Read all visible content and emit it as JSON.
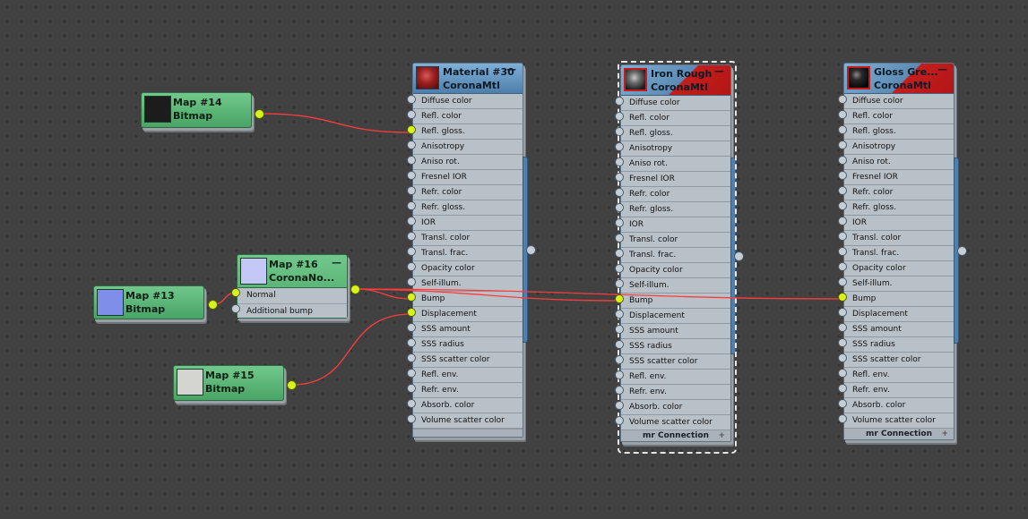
{
  "bitmap_nodes": [
    {
      "id": "map14",
      "title": "Map #14",
      "subtitle": "Bitmap",
      "thumb_color": "#1c1c1c"
    },
    {
      "id": "map13",
      "title": "Map #13",
      "subtitle": "Bitmap",
      "thumb_color": "#7f8ee8"
    },
    {
      "id": "map15",
      "title": "Map #15",
      "subtitle": "Bitmap",
      "thumb_color": "#d4d4d0"
    }
  ],
  "normal_node": {
    "title": "Map #16",
    "subtitle": "CoronaNo...",
    "collapse": "—",
    "thumb_color": "#c3c8f7",
    "slots": [
      "Normal",
      "Additional bump"
    ]
  },
  "materials": [
    {
      "id": "mat30",
      "title": "Material #30",
      "subtitle": "CoronaMtl",
      "collapse": "—",
      "thumb_style": "red",
      "footer": ""
    },
    {
      "id": "iron",
      "title": "Iron Rough",
      "subtitle": "CoronaMtl",
      "collapse": "—",
      "thumb_style": "iron",
      "footer": "mr Connection"
    },
    {
      "id": "gloss",
      "title": "Gloss Gre...",
      "subtitle": "CoronaMtl",
      "collapse": "—",
      "thumb_style": "black",
      "footer": "mr Connection"
    }
  ],
  "material_slots": [
    "Diffuse color",
    "Refl. color",
    "Refl. gloss.",
    "Anisotropy",
    "Aniso rot.",
    "Fresnel IOR",
    "Refr. color",
    "Refr. gloss.",
    "IOR",
    "Transl. color",
    "Transl. frac.",
    "Opacity color",
    "Self-illum.",
    "Bump",
    "Displacement",
    "SSS amount",
    "SSS radius",
    "SSS scatter color",
    "Refl. env.",
    "Refr. env.",
    "Absorb. color",
    "Volume scatter color"
  ],
  "footer_plus": "+",
  "colors": {
    "wire": "#ff3c3c",
    "socket_active": "#d7f21e",
    "node_green": "#5cb877",
    "header_blue": "#6a9ccb"
  }
}
